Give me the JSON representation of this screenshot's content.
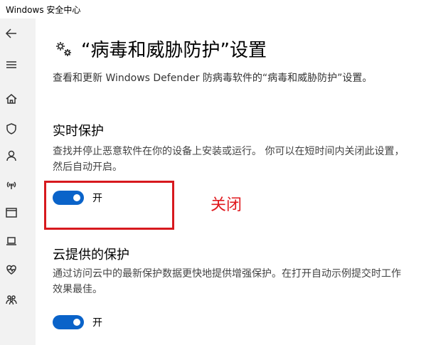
{
  "window": {
    "title": "Windows 安全中心"
  },
  "sidebar": {
    "icons": [
      "back-arrow-icon",
      "menu-icon",
      "home-icon",
      "shield-icon",
      "person-icon",
      "wifi-icon",
      "app-browser-icon",
      "laptop-icon",
      "heart-icon",
      "family-icon"
    ]
  },
  "page": {
    "title": "“病毒和威胁防护”设置",
    "description": "查看和更新 Windows Defender 防病毒软件的“病毒和威胁防护”设置。"
  },
  "realtime": {
    "title": "实时保护",
    "text": "查找并停止恶意软件在你的设备上安装或运行。 你可以在短时间内关闭此设置，然后自动开启。",
    "toggle_state": "开"
  },
  "cloud": {
    "title": "云提供的保护",
    "text": "通过访问云中的最新保护数据更快地提供增强保护。在打开自动示例提交时工作效果最佳。",
    "toggle_state": "开"
  },
  "annotation": {
    "label": "关闭",
    "color": "#e0191e"
  },
  "colors": {
    "toggle_on": "#0a63c9",
    "sidebar_bg": "#f2f2f2"
  }
}
